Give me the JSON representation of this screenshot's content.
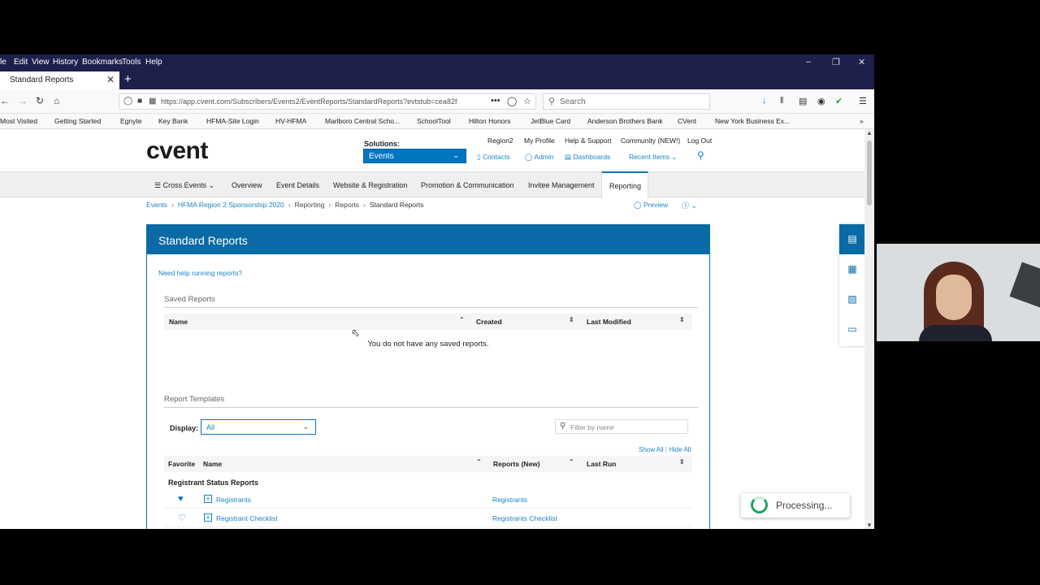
{
  "browser": {
    "menu": [
      "le",
      "Edit",
      "View",
      "History",
      "Bookmarks",
      "Tools",
      "Help"
    ],
    "tab_title": "Standard Reports",
    "url": "https://app.cvent.com/Subscribers/Events2/EventReports/StandardReports?evtstub=cea82f",
    "search_placeholder": "Search",
    "bookmarks": [
      "Most Visited",
      "Getting Started",
      "Egnyte",
      "Key Bank",
      "HFMA-Site Login",
      "HV-HFMA",
      "Marlboro Central Scho...",
      "SchoolTool",
      "Hilton Honors",
      "JetBlue Card",
      "Anderson Brothers Bank",
      "CVent",
      "New York Business Ex..."
    ]
  },
  "header": {
    "logo": "cvent",
    "solutions_label": "Solutions:",
    "solutions_value": "Events",
    "top_links": [
      "Region2",
      "My Profile",
      "Help & Support",
      "Community (NEW!)",
      "Log Out"
    ],
    "util_links": [
      "Contacts",
      "Admin",
      "Dashboards",
      "Recent Items"
    ]
  },
  "nav": {
    "items": [
      "Cross Events",
      "Overview",
      "Event Details",
      "Website & Registration",
      "Promotion & Communication",
      "Invitee Management",
      "Reporting"
    ]
  },
  "breadcrumb": {
    "items": [
      "Events",
      "HFMA Region 2 Sponsorship 2020",
      "Reporting",
      "Reports",
      "Standard Reports"
    ],
    "preview": "Preview"
  },
  "panel": {
    "title": "Standard Reports",
    "help_link": "Need help running reports?",
    "saved_title": "Saved Reports",
    "saved_cols": [
      "Name",
      "Created",
      "Last Modified"
    ],
    "no_saved": "You do not have any saved reports.",
    "templates_title": "Report Templates",
    "display_label": "Display:",
    "display_value": "All",
    "filter_placeholder": "Filter by name",
    "show_all": "Show All",
    "hide_all": "Hide All",
    "template_cols": [
      "Favorite",
      "Name",
      "Reports (New)",
      "Last Run"
    ],
    "group": "Registrant Status Reports",
    "rows": [
      {
        "name": "Registrants",
        "new": "Registrants"
      },
      {
        "name": "Registrant Checklist",
        "new": "Registrants Checklist"
      }
    ]
  },
  "processing": "Processing...",
  "colors": {
    "menubar": "#1e1f4b",
    "accent": "#0a6aa6",
    "link": "#1a84c7",
    "logo_c": "#1aa0d8",
    "spinner": "#20a060"
  }
}
